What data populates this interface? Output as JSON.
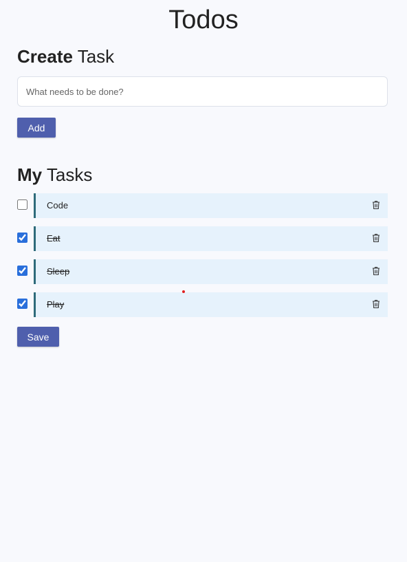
{
  "header": {
    "title": "Todos"
  },
  "create": {
    "heading_bold": "Create",
    "heading_rest": " Task",
    "input_placeholder": "What needs to be done?",
    "input_value": "",
    "add_label": "Add"
  },
  "tasks": {
    "heading_bold": "My",
    "heading_rest": " Tasks",
    "items": [
      {
        "label": "Code",
        "done": false
      },
      {
        "label": "Eat",
        "done": true
      },
      {
        "label": "Sleep",
        "done": true
      },
      {
        "label": "Play",
        "done": true
      }
    ],
    "delete_icon": "trash-icon",
    "save_label": "Save"
  },
  "colors": {
    "accent": "#4f5fad",
    "task_bg": "#e6f2fc",
    "task_border": "#2e6b7a",
    "checkbox": "#2a6fdb",
    "page_bg": "#f8f9fd"
  }
}
